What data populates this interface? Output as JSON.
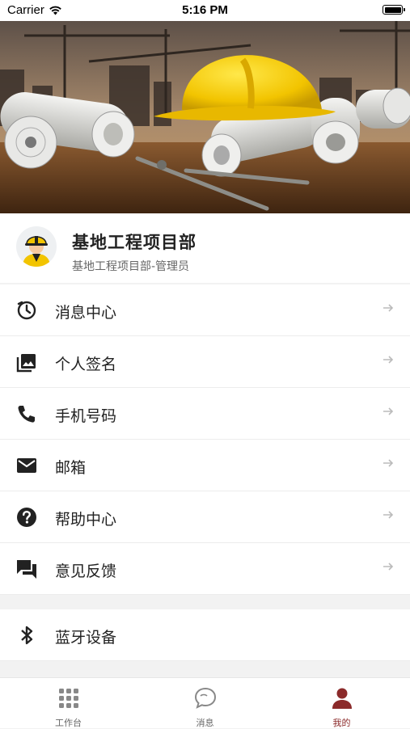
{
  "status_bar": {
    "carrier": "Carrier",
    "time": "5:16 PM"
  },
  "profile": {
    "name": "基地工程项目部",
    "role": "基地工程项目部-管理员"
  },
  "menu": [
    {
      "label": "消息中心",
      "icon": "message-clock-icon"
    },
    {
      "label": "个人签名",
      "icon": "image-icon"
    },
    {
      "label": "手机号码",
      "icon": "phone-icon"
    },
    {
      "label": "邮箱",
      "icon": "mail-icon"
    },
    {
      "label": "帮助中心",
      "icon": "help-icon"
    },
    {
      "label": "意见反馈",
      "icon": "feedback-icon"
    }
  ],
  "menu2": [
    {
      "label": "蓝牙设备",
      "icon": "bluetooth-icon"
    }
  ],
  "tabs": [
    {
      "label": "工作台",
      "icon": "grid-icon",
      "active": false
    },
    {
      "label": "消息",
      "icon": "chat-icon",
      "active": false
    },
    {
      "label": "我的",
      "icon": "person-icon",
      "active": true
    }
  ],
  "colors": {
    "accent": "#8b2a2a",
    "icon": "#222222",
    "arrow": "#bbbbbb",
    "background": "#f2f2f2"
  }
}
